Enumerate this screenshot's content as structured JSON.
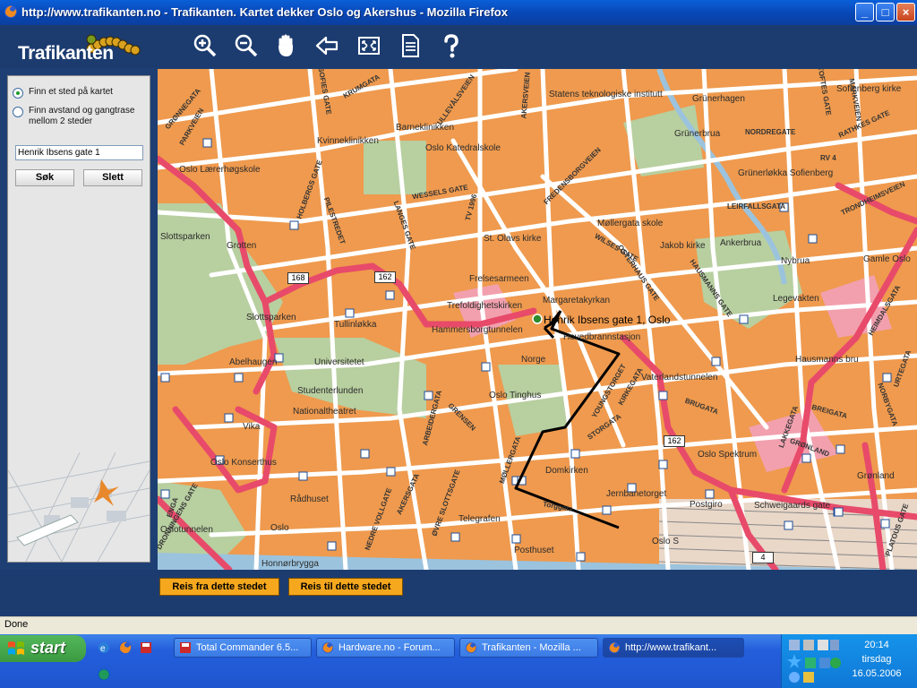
{
  "window": {
    "title": "http://www.trafikanten.no - Trafikanten. Kartet dekker Oslo og Akershus - Mozilla Firefox",
    "buttons": {
      "minimize": "_",
      "maximize": "□",
      "close": "×"
    }
  },
  "app": {
    "logo": "Trafikanten",
    "toolbar": [
      {
        "name": "zoom-in-icon"
      },
      {
        "name": "zoom-out-icon"
      },
      {
        "name": "pan-hand-icon"
      },
      {
        "name": "back-arrow-icon"
      },
      {
        "name": "fullscreen-icon"
      },
      {
        "name": "document-icon"
      },
      {
        "name": "help-icon"
      }
    ]
  },
  "panel": {
    "radio_find": "Finn et sted på kartet",
    "radio_distance": "Finn avstand og gangtrase mellom 2 steder",
    "address_value": "Henrik Ibsens gate 1",
    "search_label": "Søk",
    "clear_label": "Slett"
  },
  "map": {
    "marker_label": "Henrik Ibsens gate 1, Oslo",
    "labels": [
      "Statens teknologiske institutt",
      "Grünerhagen",
      "Sofienberg kirke",
      "Barneklinikken",
      "Oslo Katedralskole",
      "Grünerbrua",
      "NORDREGATE",
      "RATHKES GATE",
      "Kvinneklinikken",
      "Oslo Lærerhøgskole",
      "WESSELS GATE",
      "Grünerløkka Sofienberg",
      "TRONDHEIMSVEIEN",
      "LEIRFALLSGATA",
      "Møllergata skole",
      "St. Olavs kirke",
      "Jakob kirke",
      "Ankerbrua",
      "Nybrua",
      "Gamle Oslo",
      "Slottsparken",
      "Grotten",
      "Frelsesarmeen",
      "Margaretakyrkan",
      "Legevakten",
      "Trefoldighetskirken",
      "Slottsparken",
      "Tullinløkka",
      "Hammersborgtunnelen",
      "Hovedbrannstasjon",
      "Abelhaugen",
      "Universitetet",
      "Norge",
      "Vaterlandstunnelen",
      "Hausmanns bru",
      "Studenterlunden",
      "Oslo Tinghus",
      "Nationaltheatret",
      "BRUGATA",
      "BREIGATA",
      "Vika",
      "GRENSEN",
      "STORGATA",
      "GRØNLAND",
      "Oslo Konserthus",
      "Domkirken",
      "Oslo Spektrum",
      "Grønland",
      "Rådhuset",
      "Jernbanetorget",
      "Postgiro",
      "Schweigaards gate",
      "Torggata",
      "Oslotunnelen",
      "Oslo",
      "Oslo S",
      "Honnørbrygga",
      "Posthuset",
      "Telegrafen",
      "KIRKEGATA",
      "AKERSGATA",
      "ØVRE SLOTTSGATE",
      "NEDRE VOLLGATE",
      "MØLLERGATA",
      "YOUNGSTORGET",
      "HOLBERGS GATE",
      "PILESTREDET",
      "LANGES GATE",
      "FREDENSBORGVEIEN",
      "OSTERHAUS GATE",
      "HAUSMANNS GATE",
      "MARKVEIEN",
      "HEIMDALSGATA",
      "PARKVEIEN",
      "SOFIES GATE",
      "AKERSVEIEN",
      "DRONNINGENS GATE",
      "ARBEIDERGATA",
      "GRØNNEGATA",
      "ULLEVÅLSVEIEN",
      "TOFTES GATE",
      "NORBYGATA",
      "URTEGATA",
      "LAKKEGATA",
      "PLATOUS GATE",
      "TV 1996",
      "WILSES GATE",
      "ENGA",
      "RV 4",
      "KRUMGATA"
    ],
    "road_numbers": [
      "168",
      "162",
      "162",
      "4"
    ]
  },
  "bottom": {
    "from_label": "Reis fra dette stedet",
    "to_label": "Reis til dette stedet"
  },
  "status": "Done",
  "taskbar": {
    "start": "start",
    "tasks": [
      "Total Commander 6.5...",
      "Hardware.no - Forum...",
      "Trafikanten - Mozilla ...",
      "http://www.trafikant..."
    ],
    "clock_time": "20:14",
    "clock_day": "tirsdag",
    "clock_date": "16.05.2006"
  },
  "colors": {
    "header": "#1c3c70",
    "map_block": "#ef9a4e",
    "main_road": "#e84a6a",
    "park": "#b8cfa0",
    "button_orange": "#f5a81e"
  }
}
